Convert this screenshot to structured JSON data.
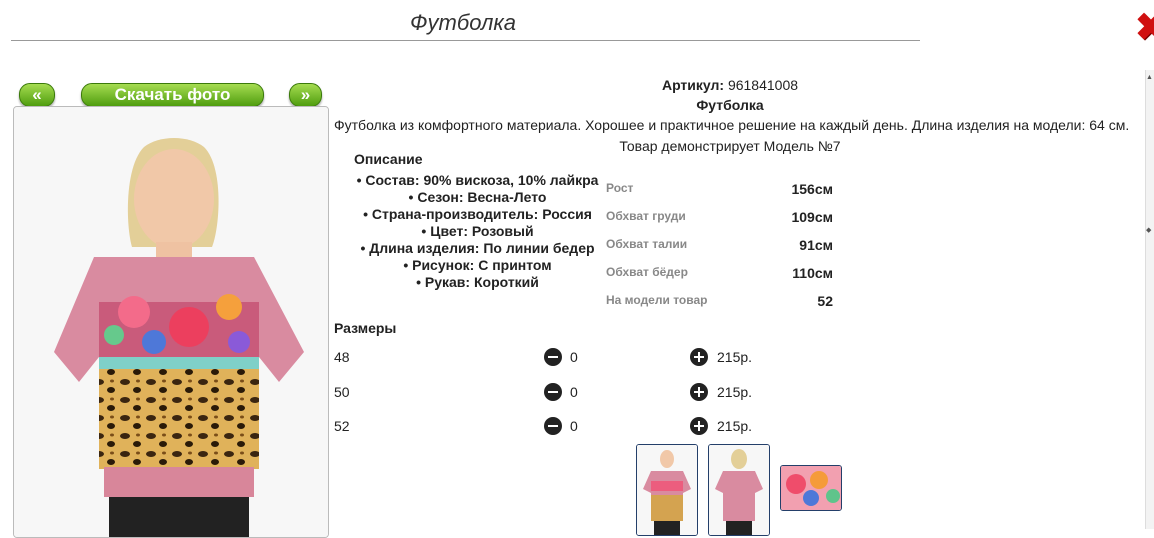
{
  "page": {
    "title": "Футболка"
  },
  "nav": {
    "prev_label": "«",
    "download_label": "Скачать фото",
    "next_label": "»"
  },
  "product": {
    "article_label": "Артикул:",
    "article_value": "961841008",
    "name": "Футболка",
    "description": "Футболка из комфортного материала. Хорошее и практичное решение на каждый день. Длина изделия на модели: 64 см.",
    "model_note": "Товар демонстрирует Модель №7"
  },
  "details": {
    "heading": "Описание",
    "items": [
      "Состав: 90% вискоза, 10% лайкра",
      "Сезон: Весна-Лето",
      "Страна-производитель: Россия",
      "Цвет: Розовый",
      "Длина изделия: По линии бедер",
      "Рисунок: С принтом",
      "Рукав: Короткий"
    ]
  },
  "model_params": [
    {
      "label": "Рост",
      "value": "156см"
    },
    {
      "label": "Обхват груди",
      "value": "109см"
    },
    {
      "label": "Обхват талии",
      "value": "91см"
    },
    {
      "label": "Обхват бёдер",
      "value": "110см"
    },
    {
      "label": "На модели товар",
      "value": "52"
    }
  ],
  "sizes": {
    "heading": "Размеры",
    "rows": [
      {
        "size": "48",
        "qty": "0",
        "price": "215р."
      },
      {
        "size": "50",
        "qty": "0",
        "price": "215р."
      },
      {
        "size": "52",
        "qty": "0",
        "price": "215р."
      }
    ]
  },
  "colors": {
    "accent_green": "#5aa815",
    "close_red": "#d01010",
    "thumb_border": "#243f6a",
    "shirt_pink": "#d7869a"
  },
  "icons": {
    "close": "close-icon",
    "minus": "minus-circle-icon",
    "plus": "plus-circle-icon"
  }
}
